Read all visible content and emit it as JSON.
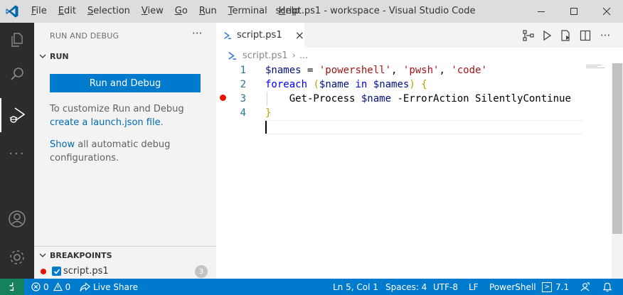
{
  "titlebar": {
    "menu": [
      "File",
      "Edit",
      "Selection",
      "View",
      "Go",
      "Run",
      "Terminal",
      "Help"
    ],
    "menu_mnemonics": [
      "F",
      "E",
      "S",
      "V",
      "G",
      "R",
      "T",
      "H"
    ],
    "window_title": "script.ps1 - workspace - Visual Studio Code"
  },
  "sidebar": {
    "title": "RUN AND DEBUG",
    "more": "···",
    "run_section": {
      "title": "RUN",
      "button": "Run and Debug",
      "text1": "To customize Run and Debug",
      "link1": "create a launch.json file",
      "text1_end": ".",
      "link2": "Show",
      "text2": " all automatic debug",
      "text2_line2": "configurations."
    },
    "breakpoints_section": {
      "title": "BREAKPOINTS",
      "items": [
        {
          "label": "script.ps1",
          "count": "3"
        }
      ]
    }
  },
  "editor": {
    "tab_label": "script.ps1",
    "close": "×",
    "breadcrumb": {
      "file": "script.ps1",
      "sep": "›",
      "rest": "..."
    },
    "line_numbers": [
      "1",
      "2",
      "3",
      "4"
    ],
    "code": {
      "l1": [
        {
          "t": "$names",
          "c": "var"
        },
        {
          "t": " = ",
          "c": "def"
        },
        {
          "t": "'powershell'",
          "c": "str"
        },
        {
          "t": ", ",
          "c": "def"
        },
        {
          "t": "'pwsh'",
          "c": "str"
        },
        {
          "t": ", ",
          "c": "def"
        },
        {
          "t": "'code'",
          "c": "str"
        }
      ],
      "l2": [
        {
          "t": "foreach",
          "c": "kw"
        },
        {
          "t": " ",
          "c": "def"
        },
        {
          "t": "(",
          "c": "br"
        },
        {
          "t": "$name",
          "c": "var"
        },
        {
          "t": " in ",
          "c": "kw"
        },
        {
          "t": "$names",
          "c": "var"
        },
        {
          "t": ")",
          "c": "br"
        },
        {
          "t": " ",
          "c": "def"
        },
        {
          "t": "{",
          "c": "br"
        }
      ],
      "l3": [
        {
          "t": "    Get-Process ",
          "c": "def"
        },
        {
          "t": "$name",
          "c": "var"
        },
        {
          "t": " -ErrorAction SilentlyContinue",
          "c": "def"
        }
      ],
      "l4": [
        {
          "t": "}",
          "c": "br"
        }
      ]
    },
    "breakpoint_line": 3
  },
  "statusbar": {
    "errors": "0",
    "warnings": "0",
    "live_share": "Live Share",
    "position": "Ln 5, Col 1",
    "spaces": "Spaces: 4",
    "encoding": "UTF-8",
    "eol": "LF",
    "language": "PowerShell",
    "ps_version": "7.1"
  },
  "colors": {
    "accent": "#007acc",
    "breakpoint": "#e51400",
    "remote": "#16825d"
  }
}
